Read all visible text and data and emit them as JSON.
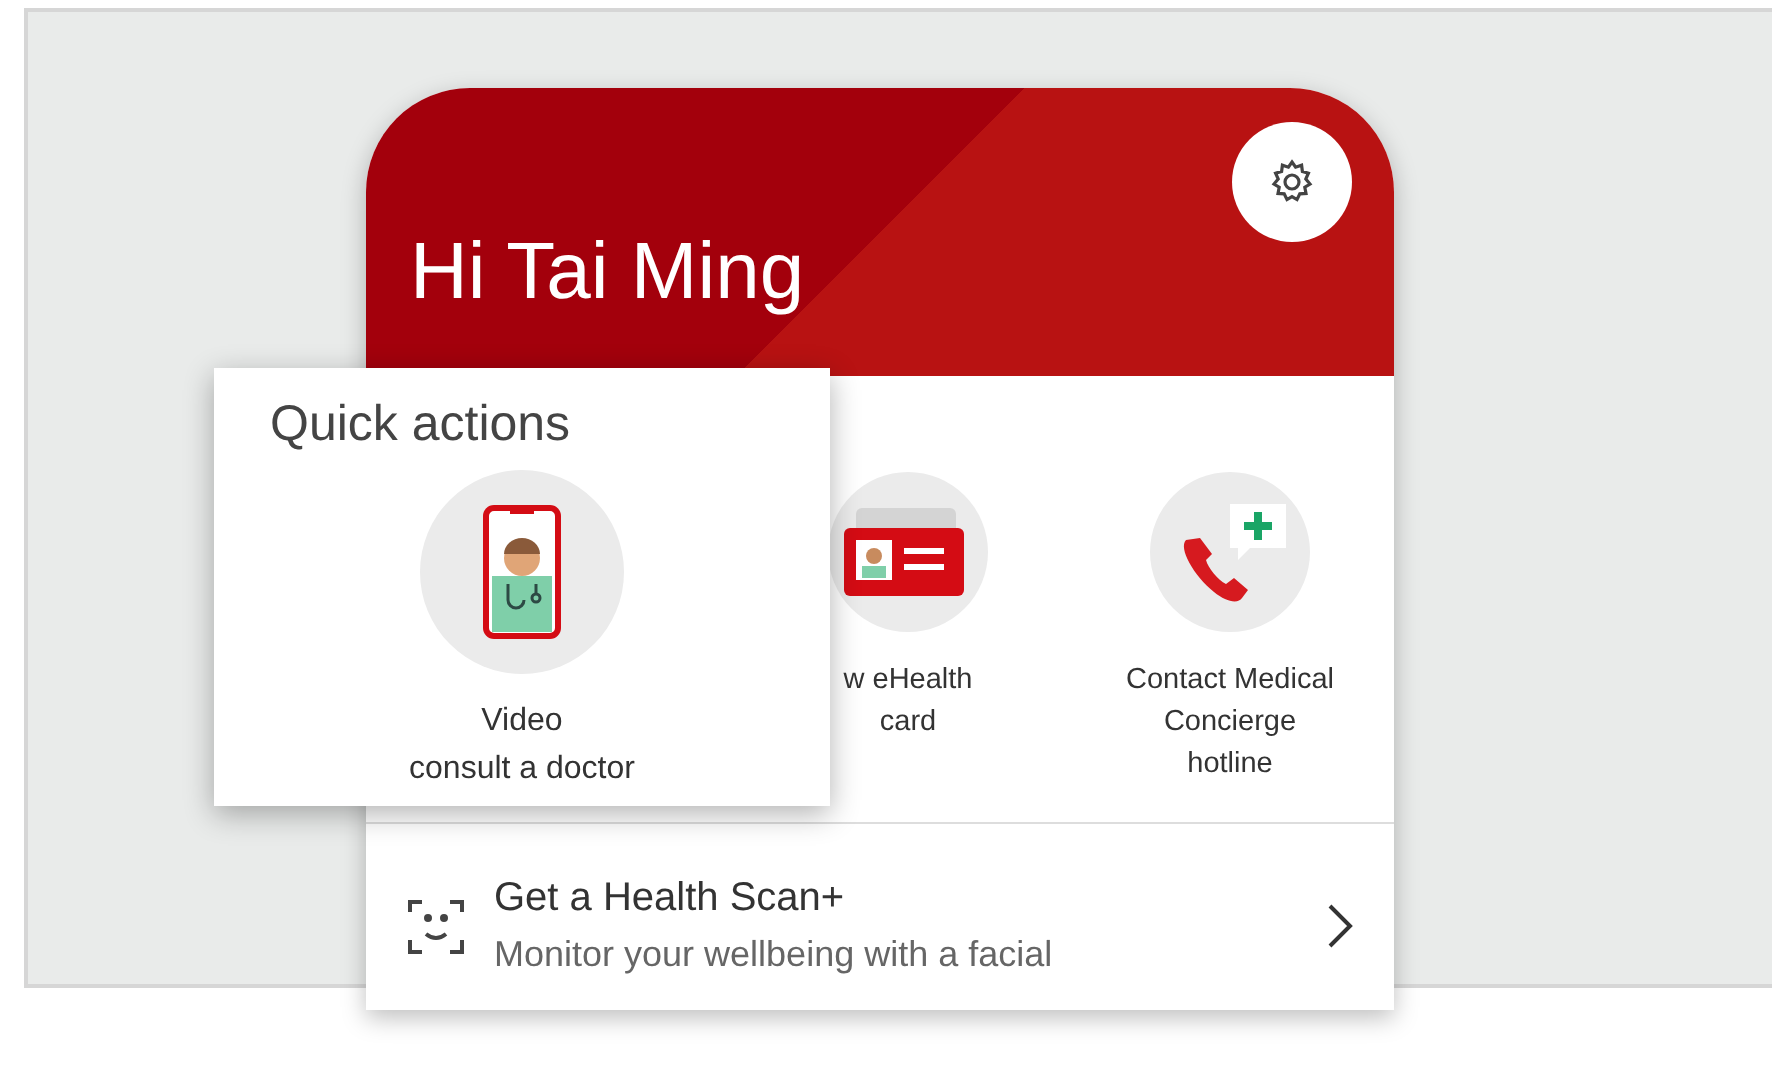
{
  "header": {
    "greeting": "Hi Tai Ming"
  },
  "actions": [
    {
      "kind": "card",
      "label_lines": [
        "w eHealth",
        "card"
      ]
    },
    {
      "kind": "phone",
      "label_lines": [
        "Contact Medical",
        "Concierge",
        "hotline"
      ]
    }
  ],
  "quick_actions": {
    "title": "Quick actions",
    "item": {
      "kind": "video",
      "label_lines": [
        "Video",
        "consult a doctor"
      ]
    }
  },
  "list_items": [
    {
      "title": "Get a Health Scan+",
      "subtitle": "Monitor your wellbeing with a facial"
    }
  ]
}
